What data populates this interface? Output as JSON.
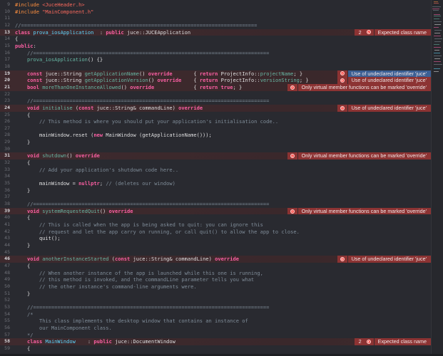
{
  "colors": {
    "background": "#292a30",
    "keyword": "#fc5fa3",
    "error_bubble": "#8c3333",
    "selected_bubble": "#3b5f94",
    "comment": "#7f8c98"
  },
  "lines": [
    {
      "num": "9",
      "tokens": [
        [
          "pp",
          "#include "
        ],
        [
          "str",
          "<JuceHeader.h>"
        ]
      ]
    },
    {
      "num": "10",
      "tokens": [
        [
          "pp",
          "#include "
        ],
        [
          "str",
          "\"MainComponent.h\""
        ]
      ]
    },
    {
      "num": "11",
      "tokens": []
    },
    {
      "num": "12",
      "tokens": [
        [
          "cm",
          "//=============================================================================="
        ]
      ]
    },
    {
      "num": "13",
      "tokens": [
        [
          "kw",
          "class "
        ],
        [
          "decl",
          "prova_iosApplication"
        ],
        [
          "pl",
          "  : "
        ],
        [
          "kw",
          "public "
        ],
        [
          "pl",
          "juce::JUCEApplication"
        ]
      ]
    },
    {
      "num": "14",
      "tokens": [
        [
          "pl",
          "{"
        ]
      ]
    },
    {
      "num": "15",
      "tokens": [
        [
          "kw",
          "public"
        ],
        [
          "pl",
          ":"
        ]
      ]
    },
    {
      "num": "16",
      "tokens": [
        [
          "pl",
          "    "
        ],
        [
          "cm",
          "//=============================================================================="
        ]
      ]
    },
    {
      "num": "17",
      "tokens": [
        [
          "pl",
          "    "
        ],
        [
          "fn",
          "prova_iosApplication"
        ],
        [
          "pl",
          "() {}"
        ]
      ]
    },
    {
      "num": "18",
      "tokens": []
    },
    {
      "num": "19",
      "tokens": [
        [
          "pl",
          "    "
        ],
        [
          "kw",
          "const "
        ],
        [
          "pl",
          "juce::String "
        ],
        [
          "fn",
          "getApplicationName"
        ],
        [
          "pl",
          "() "
        ],
        [
          "kw",
          "override"
        ],
        [
          "pl",
          "       { "
        ],
        [
          "kw",
          "return "
        ],
        [
          "pl",
          "ProjectInfo::"
        ],
        [
          "fn",
          "projectName"
        ],
        [
          "pl",
          "; }"
        ]
      ]
    },
    {
      "num": "20",
      "tokens": [
        [
          "pl",
          "    "
        ],
        [
          "kw",
          "const "
        ],
        [
          "pl",
          "juce::String "
        ],
        [
          "fn",
          "getApplicationVersion"
        ],
        [
          "pl",
          "() "
        ],
        [
          "kw",
          "override"
        ],
        [
          "pl",
          "    { "
        ],
        [
          "kw",
          "return "
        ],
        [
          "pl",
          "ProjectInfo::"
        ],
        [
          "fn",
          "versionString"
        ],
        [
          "pl",
          "; }"
        ]
      ]
    },
    {
      "num": "21",
      "tokens": [
        [
          "pl",
          "    "
        ],
        [
          "kw",
          "bool "
        ],
        [
          "fn",
          "moreThanOneInstanceAllowed"
        ],
        [
          "pl",
          "() "
        ],
        [
          "kw",
          "override"
        ],
        [
          "pl",
          "             { "
        ],
        [
          "kw",
          "return true"
        ],
        [
          "pl",
          "; }"
        ]
      ]
    },
    {
      "num": "22",
      "tokens": []
    },
    {
      "num": "23",
      "tokens": [
        [
          "pl",
          "    "
        ],
        [
          "cm",
          "//=============================================================================="
        ]
      ]
    },
    {
      "num": "24",
      "tokens": [
        [
          "pl",
          "    "
        ],
        [
          "kw",
          "void "
        ],
        [
          "fn",
          "initialise"
        ],
        [
          "pl",
          " ("
        ],
        [
          "kw",
          "const "
        ],
        [
          "pl",
          "juce::String& commandLine) "
        ],
        [
          "kw",
          "override"
        ]
      ]
    },
    {
      "num": "25",
      "tokens": [
        [
          "pl",
          "    {"
        ]
      ]
    },
    {
      "num": "26",
      "tokens": [
        [
          "pl",
          "        "
        ],
        [
          "cm",
          "// This method is where you should put your application's initialisation code.."
        ]
      ]
    },
    {
      "num": "27",
      "tokens": []
    },
    {
      "num": "28",
      "tokens": [
        [
          "pl",
          "        mainWindow.reset ("
        ],
        [
          "kw",
          "new "
        ],
        [
          "pl",
          "MainWindow (getApplicationName()));"
        ]
      ]
    },
    {
      "num": "29",
      "tokens": [
        [
          "pl",
          "    }"
        ]
      ]
    },
    {
      "num": "30",
      "tokens": []
    },
    {
      "num": "31",
      "tokens": [
        [
          "pl",
          "    "
        ],
        [
          "kw",
          "void "
        ],
        [
          "fn",
          "shutdown"
        ],
        [
          "pl",
          "() "
        ],
        [
          "kw",
          "override"
        ]
      ]
    },
    {
      "num": "32",
      "tokens": [
        [
          "pl",
          "    {"
        ]
      ]
    },
    {
      "num": "33",
      "tokens": [
        [
          "pl",
          "        "
        ],
        [
          "cm",
          "// Add your application's shutdown code here.."
        ]
      ]
    },
    {
      "num": "34",
      "tokens": []
    },
    {
      "num": "35",
      "tokens": [
        [
          "pl",
          "        mainWindow = "
        ],
        [
          "kw",
          "nullptr"
        ],
        [
          "pl",
          "; "
        ],
        [
          "cm",
          "// (deletes our window)"
        ]
      ]
    },
    {
      "num": "36",
      "tokens": [
        [
          "pl",
          "    }"
        ]
      ]
    },
    {
      "num": "37",
      "tokens": []
    },
    {
      "num": "38",
      "tokens": [
        [
          "pl",
          "    "
        ],
        [
          "cm",
          "//=============================================================================="
        ]
      ]
    },
    {
      "num": "39",
      "tokens": [
        [
          "pl",
          "    "
        ],
        [
          "kw",
          "void "
        ],
        [
          "fn",
          "systemRequestedQuit"
        ],
        [
          "pl",
          "() "
        ],
        [
          "kw",
          "override"
        ]
      ]
    },
    {
      "num": "40",
      "tokens": [
        [
          "pl",
          "    {"
        ]
      ]
    },
    {
      "num": "41",
      "tokens": [
        [
          "pl",
          "        "
        ],
        [
          "cm",
          "// This is called when the app is being asked to quit: you can ignore this"
        ]
      ]
    },
    {
      "num": "42",
      "tokens": [
        [
          "pl",
          "        "
        ],
        [
          "cm",
          "// request and let the app carry on running, or call quit() to allow the app to close."
        ]
      ]
    },
    {
      "num": "43",
      "tokens": [
        [
          "pl",
          "        quit();"
        ]
      ]
    },
    {
      "num": "44",
      "tokens": [
        [
          "pl",
          "    }"
        ]
      ]
    },
    {
      "num": "45",
      "tokens": []
    },
    {
      "num": "46",
      "tokens": [
        [
          "pl",
          "    "
        ],
        [
          "kw",
          "void "
        ],
        [
          "fn",
          "anotherInstanceStarted"
        ],
        [
          "pl",
          " ("
        ],
        [
          "kw",
          "const "
        ],
        [
          "pl",
          "juce::String& commandLine) "
        ],
        [
          "kw",
          "override"
        ]
      ]
    },
    {
      "num": "47",
      "tokens": [
        [
          "pl",
          "    {"
        ]
      ]
    },
    {
      "num": "48",
      "tokens": [
        [
          "pl",
          "        "
        ],
        [
          "cm",
          "// When another instance of the app is launched while this one is running,"
        ]
      ]
    },
    {
      "num": "49",
      "tokens": [
        [
          "pl",
          "        "
        ],
        [
          "cm",
          "// this method is invoked, and the commandLine parameter tells you what"
        ]
      ]
    },
    {
      "num": "50",
      "tokens": [
        [
          "pl",
          "        "
        ],
        [
          "cm",
          "// the other instance's command-line arguments were."
        ]
      ]
    },
    {
      "num": "51",
      "tokens": [
        [
          "pl",
          "    }"
        ]
      ]
    },
    {
      "num": "52",
      "tokens": []
    },
    {
      "num": "53",
      "tokens": [
        [
          "pl",
          "    "
        ],
        [
          "cm",
          "//=============================================================================="
        ]
      ]
    },
    {
      "num": "54",
      "tokens": [
        [
          "pl",
          "    "
        ],
        [
          "cm",
          "/*"
        ]
      ]
    },
    {
      "num": "55",
      "tokens": [
        [
          "pl",
          "        "
        ],
        [
          "cm",
          "This class implements the desktop window that contains an instance of"
        ]
      ]
    },
    {
      "num": "56",
      "tokens": [
        [
          "pl",
          "        "
        ],
        [
          "cm",
          "our MainComponent class."
        ]
      ]
    },
    {
      "num": "57",
      "tokens": [
        [
          "pl",
          "    "
        ],
        [
          "cm",
          "*/"
        ]
      ]
    },
    {
      "num": "58",
      "tokens": [
        [
          "pl",
          "    "
        ],
        [
          "kw",
          "class "
        ],
        [
          "decl",
          "MainWindow"
        ],
        [
          "pl",
          "    : "
        ],
        [
          "kw",
          "public "
        ],
        [
          "pl",
          "juce::DocumentWindow"
        ]
      ]
    },
    {
      "num": "59",
      "tokens": [
        [
          "pl",
          "    {"
        ]
      ]
    }
  ],
  "errors": [
    {
      "line": "13",
      "count": "2",
      "message": "Expected class name"
    },
    {
      "line": "19",
      "message": "Use of undeclared identifier 'juce'",
      "selected": true
    },
    {
      "line": "20",
      "message": "Use of undeclared identifier 'juce'"
    },
    {
      "line": "21",
      "message": "Only virtual member functions can be marked 'override'"
    },
    {
      "line": "24",
      "message": "Use of undeclared identifier 'juce'"
    },
    {
      "line": "31",
      "message": "Only virtual member functions can be marked 'override'"
    },
    {
      "line": "39",
      "message": "Only virtual member functions can be marked 'override'"
    },
    {
      "line": "46",
      "message": "Use of undeclared identifier 'juce'"
    },
    {
      "line": "58",
      "count": "2",
      "message": "Expected class name"
    }
  ]
}
